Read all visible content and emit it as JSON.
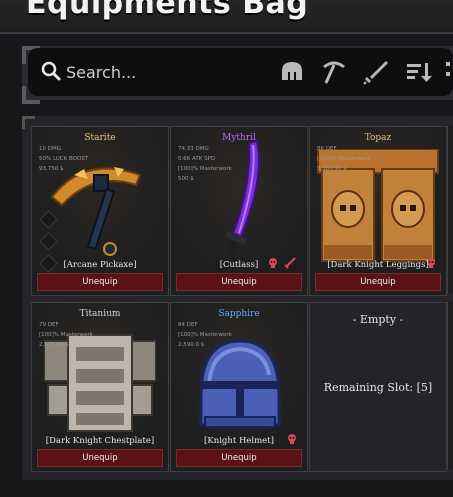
{
  "window": {
    "title": "Equipments Bag"
  },
  "search": {
    "placeholder": "Search..."
  },
  "toolbar": {
    "icons": [
      "helmet-icon",
      "pickaxe-icon",
      "sword-icon",
      "sort-icon"
    ]
  },
  "colors": {
    "unequip_bg": "#5a1214",
    "starite": "#e9c979",
    "mythril": "#b86cff",
    "topaz": "#e7c07a",
    "titanium": "#d8d8d8",
    "sapphire": "#6aa6ff"
  },
  "items": [
    {
      "name": "Starite",
      "stats": [
        "10 DMG",
        "50% LUCK BOOST",
        "93,750 $"
      ],
      "type": "[Arcane Pickaxe]",
      "button": "Unequip"
    },
    {
      "name": "Mythril",
      "stats": [
        "74.33 DMG",
        "0.66 ATK SPD",
        "[100]% Masterwork",
        "500 $"
      ],
      "type": "[Cutlass]",
      "button": "Unequip"
    },
    {
      "name": "Topaz",
      "stats": [
        "86 DEF",
        "[100]% Masterwork",
        "3,300.90 $"
      ],
      "type": "[Dark Knight Leggings]",
      "button": "Unequip"
    },
    {
      "name": "Titanium",
      "stats": [
        "79 DEF",
        "[100]% Masterwork",
        "2,575.50 $"
      ],
      "type": "[Dark Knight Chestplate]",
      "button": "Unequip"
    },
    {
      "name": "Sapphire",
      "stats": [
        "84 DEF",
        "[100]% Masterwork",
        "2,590.0 $"
      ],
      "type": "[Knight Helmet]",
      "button": "Unequip"
    }
  ],
  "empty_slot": {
    "title": "- Empty -",
    "remaining": "Remaining Slot: [5]"
  }
}
